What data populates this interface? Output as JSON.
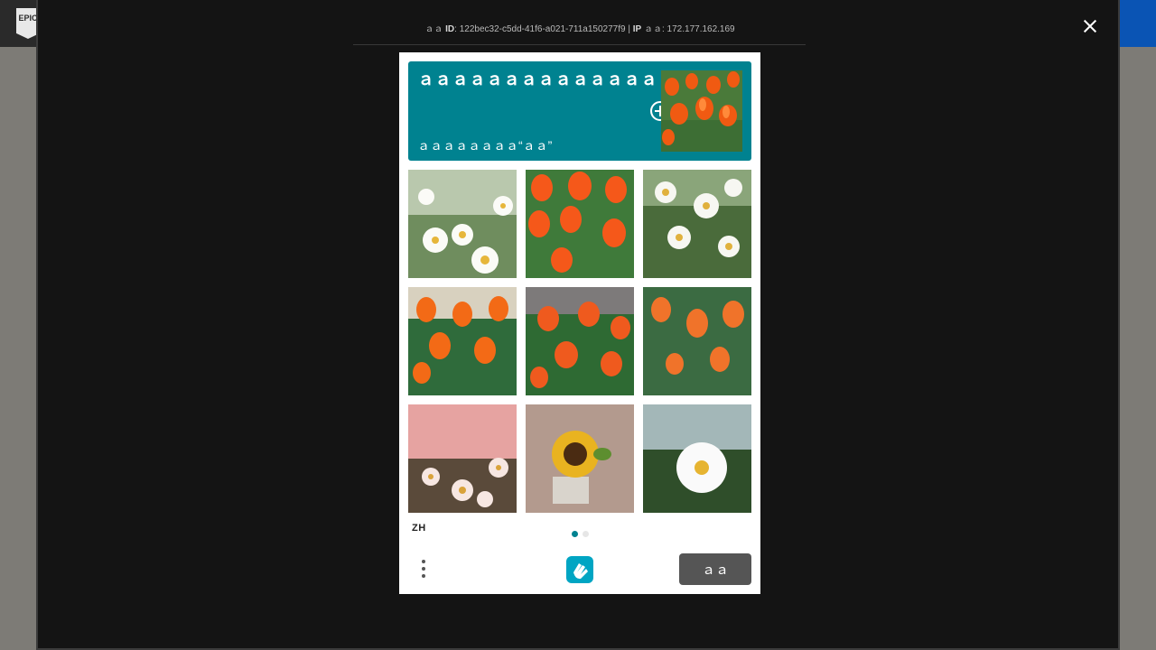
{
  "header": {
    "logo_text": "EPIC"
  },
  "ray": {
    "id_prefix": "ａａ",
    "id_label": "ID",
    "id_value": "122bec32-c5dd-41f6-a021-711a150277f9",
    "sep": "|",
    "ip_label": "IP",
    "ip_suffix": "ａａ",
    "ip_value": "172.177.162.169"
  },
  "challenge": {
    "title": "ａａａａａａａａａａａａａａ",
    "subtitle": "ａａａａａａａａ“ａａ”",
    "example_icon": "tulip-field-image",
    "tiles": [
      {
        "subject": "daisies"
      },
      {
        "subject": "tulips"
      },
      {
        "subject": "daisies"
      },
      {
        "subject": "tulips"
      },
      {
        "subject": "tulips"
      },
      {
        "subject": "tulips"
      },
      {
        "subject": "daisies-pink"
      },
      {
        "subject": "sunflower"
      },
      {
        "subject": "daisy"
      }
    ],
    "language": "ZH",
    "pagination": {
      "current": 1,
      "total": 2
    },
    "skip_label": "ａａ"
  },
  "colors": {
    "accent": "#008290",
    "overlay": "#141414",
    "skip_button": "#555555"
  }
}
